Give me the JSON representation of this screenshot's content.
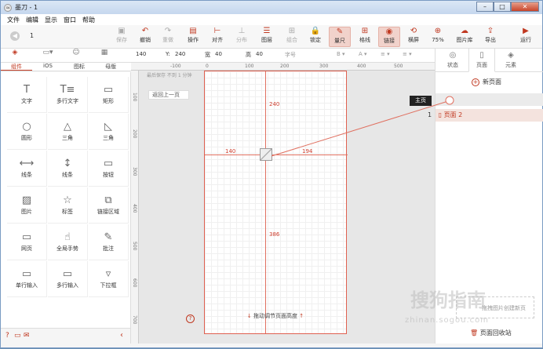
{
  "window": {
    "title": "墨刀 - 1",
    "app_icon": "≈"
  },
  "menu": [
    "文件",
    "编辑",
    "显示",
    "窗口",
    "帮助"
  ],
  "toolbar": {
    "page_number": "1",
    "tools": [
      {
        "id": "save",
        "label": "保存",
        "icon": "▣",
        "gray": true
      },
      {
        "id": "undo",
        "label": "撤销",
        "icon": "↶",
        "gray": false
      },
      {
        "id": "redo",
        "label": "重做",
        "icon": "↷",
        "gray": true
      },
      {
        "id": "operate",
        "label": "操作",
        "icon": "▤",
        "gray": false
      },
      {
        "id": "align",
        "label": "对齐",
        "icon": "⊢",
        "gray": false
      },
      {
        "id": "distribute",
        "label": "分布",
        "icon": "⊥",
        "gray": true
      },
      {
        "id": "layer",
        "label": "图层",
        "icon": "☰",
        "gray": false
      },
      {
        "id": "group",
        "label": "组合",
        "icon": "⊞",
        "gray": true
      },
      {
        "id": "lock",
        "label": "锁定",
        "icon": "🔒",
        "gray": false
      },
      {
        "id": "ruler",
        "label": "量尺",
        "icon": "✎",
        "gray": false,
        "active": true
      },
      {
        "id": "grid",
        "label": "格线",
        "icon": "⊞",
        "gray": false
      },
      {
        "id": "link",
        "label": "链接",
        "icon": "◉",
        "gray": false,
        "active": true
      },
      {
        "id": "landscape",
        "label": "横屏",
        "icon": "⟲",
        "gray": false
      },
      {
        "id": "zoom",
        "label": "75%",
        "icon": "⊕",
        "gray": false
      },
      {
        "id": "gallery",
        "label": "图片库",
        "icon": "☁",
        "gray": false
      },
      {
        "id": "export",
        "label": "导出",
        "icon": "⇪",
        "gray": false
      },
      {
        "id": "run",
        "label": "运行",
        "icon": "▶",
        "gray": false
      }
    ]
  },
  "properties": {
    "x_value": "140",
    "y_label": "Y:",
    "y_value": "240",
    "w_label": "宽",
    "w_value": "40",
    "h_label": "高",
    "h_value": "40",
    "font_label": "字号"
  },
  "left_tabs": [
    {
      "label": "组件",
      "icon": "◈",
      "active": true
    },
    {
      "label": "iOS",
      "icon": "",
      "active": false
    },
    {
      "label": "图标",
      "icon": "☺",
      "active": false
    },
    {
      "label": "母版",
      "icon": "▦",
      "active": false
    }
  ],
  "components": [
    {
      "label": "文字",
      "icon": "T"
    },
    {
      "label": "多行文字",
      "icon": "T≡"
    },
    {
      "label": "矩形",
      "icon": "▭"
    },
    {
      "label": "圆形",
      "icon": "○"
    },
    {
      "label": "三角",
      "icon": "△"
    },
    {
      "label": "三角",
      "icon": "◺"
    },
    {
      "label": "线条",
      "icon": "⟷"
    },
    {
      "label": "线条",
      "icon": "↕"
    },
    {
      "label": "按钮",
      "icon": "▭"
    },
    {
      "label": "图片",
      "icon": "▨"
    },
    {
      "label": "标签",
      "icon": "☆"
    },
    {
      "label": "链接区域",
      "icon": "⧉"
    },
    {
      "label": "网页",
      "icon": "▭"
    },
    {
      "label": "全局手势",
      "icon": "☝"
    },
    {
      "label": "批注",
      "icon": "✎"
    },
    {
      "label": "单行输入",
      "icon": "▭"
    },
    {
      "label": "多行输入",
      "icon": "▭"
    },
    {
      "label": "下拉框",
      "icon": "▿"
    }
  ],
  "canvas": {
    "ruler_top": [
      "-100",
      "0",
      "100",
      "200",
      "300",
      "400",
      "500"
    ],
    "ruler_left": [
      "100",
      "200",
      "300",
      "400",
      "500",
      "600",
      "700"
    ],
    "save_hint": "最后保存  不到 1 分钟",
    "back_button": "返回上一页",
    "measure_top": "240",
    "measure_left": "140",
    "measure_right": "194",
    "measure_bottom": "386",
    "footer_hint": "拖动调节页面高度"
  },
  "right_panel": {
    "tabs": [
      {
        "label": "状态",
        "icon": "◎"
      },
      {
        "label": "页面",
        "icon": "▯",
        "active": true
      },
      {
        "label": "元素",
        "icon": "◈"
      }
    ],
    "new_page": "新页面",
    "pages": [
      {
        "index": "",
        "name": ""
      },
      {
        "index": "1",
        "name": "页面 2"
      }
    ],
    "tooltip": "主页",
    "drop_hint": "拖拽图片创建新页",
    "trash": "页面回收站"
  },
  "watermark": {
    "main": "搜狗指南",
    "sub": "zhinan.sogou.com"
  }
}
